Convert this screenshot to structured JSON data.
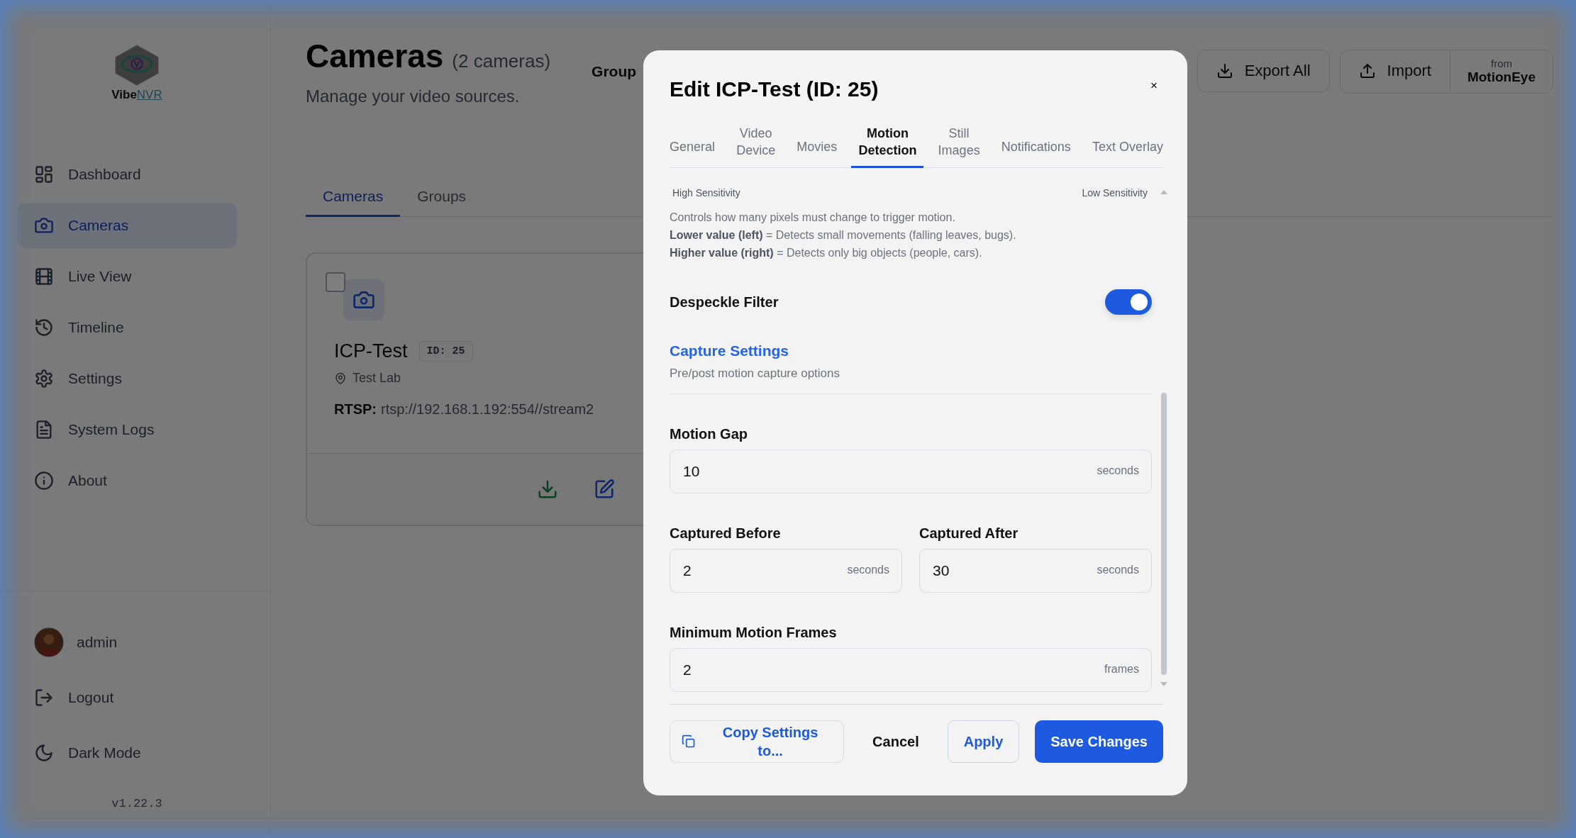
{
  "sidebar": {
    "logo": {
      "word": "Vibe",
      "accent": "NVR"
    },
    "items": [
      {
        "label": "Dashboard",
        "selected": false
      },
      {
        "label": "Cameras",
        "selected": true
      },
      {
        "label": "Live View",
        "selected": false
      },
      {
        "label": "Timeline",
        "selected": false
      },
      {
        "label": "Settings",
        "selected": false
      },
      {
        "label": "System Logs",
        "selected": false
      },
      {
        "label": "About",
        "selected": false
      }
    ],
    "user": {
      "name": "admin"
    },
    "actions": [
      {
        "label": "Logout"
      },
      {
        "label": "Dark Mode"
      }
    ],
    "version": "v1.22.3"
  },
  "header": {
    "title": "Cameras",
    "count": "(2 cameras)",
    "subtitle": "Manage your video sources.",
    "group_label": "Group",
    "buttons": [
      {
        "label": "Export All"
      },
      {
        "label": "Import"
      }
    ],
    "from_button": {
      "small": "from",
      "label": "MotionEye"
    }
  },
  "page_tabs": [
    {
      "label": "Cameras",
      "selected": true
    },
    {
      "label": "Groups",
      "selected": false
    }
  ],
  "camera_card": {
    "checked": false,
    "name": "ICP-Test",
    "id_badge": "ID: 25",
    "location": "Test Lab",
    "rtsp_label": "RTSP:",
    "rtsp_url": "rtsp://192.168.1.192:554//stream2"
  },
  "modal": {
    "title": "Edit ICP-Test (ID: 25)",
    "close": "×",
    "tabs": [
      {
        "lines": [
          "General"
        ],
        "selected": false
      },
      {
        "lines": [
          "Video",
          "Device"
        ],
        "selected": false
      },
      {
        "lines": [
          "Movies"
        ],
        "selected": false
      },
      {
        "lines": [
          "Motion",
          "Detection"
        ],
        "selected": true
      },
      {
        "lines": [
          "Still",
          "Images"
        ],
        "selected": false
      },
      {
        "lines": [
          "Notifications"
        ],
        "selected": false
      },
      {
        "lines": [
          "Text Overlay"
        ],
        "selected": false
      }
    ],
    "slider_labels": {
      "left": "High Sensitivity",
      "right": "Low Sensitivity"
    },
    "help": [
      "Controls how many pixels must change to trigger motion.",
      "**Lower value (left)** = Detects small movements (falling leaves, bugs).",
      "**Higher value (right)** = Detects only big objects (people, cars)."
    ],
    "despeckle": {
      "label": "Despeckle Filter",
      "on": true
    },
    "section": {
      "title": "Capture Settings",
      "subtitle": "Pre/post motion capture options"
    },
    "field_rows": [
      [
        {
          "label": "Motion Gap",
          "value": "10",
          "unit": "seconds"
        }
      ],
      [
        {
          "label": "Captured Before",
          "value": "2",
          "unit": "seconds"
        },
        {
          "label": "Captured After",
          "value": "30",
          "unit": "seconds"
        }
      ],
      [
        {
          "label": "Minimum Motion Frames",
          "value": "2",
          "unit": "frames"
        }
      ]
    ],
    "footer": [
      {
        "kind": "copy",
        "label": "Copy Settings to..."
      },
      {
        "kind": "plain",
        "label": "Cancel"
      },
      {
        "kind": "outline",
        "label": "Apply"
      },
      {
        "kind": "primary",
        "label": "Save Changes"
      }
    ]
  }
}
